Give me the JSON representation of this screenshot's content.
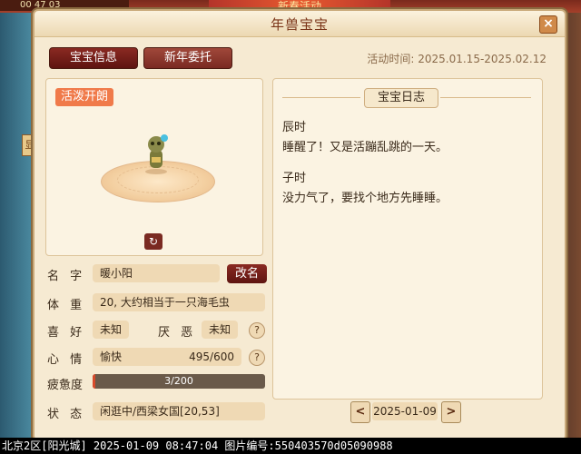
{
  "background": {
    "clock": "00 47 03",
    "banner": "新春活动",
    "side_button": "显"
  },
  "window": {
    "title": "年兽宝宝",
    "close_symbol": "×"
  },
  "tabs": [
    {
      "label": "宝宝信息",
      "active": true
    },
    {
      "label": "新年委托",
      "active": false
    }
  ],
  "activity_time": "活动时间: 2025.01.15-2025.02.12",
  "pet": {
    "mood_badge": "活泼开朗",
    "rotate_symbol": "↻"
  },
  "info": {
    "name_label": "名  字",
    "name_value": "暖小阳",
    "rename_button": "改名",
    "weight_label": "体  重",
    "weight_value": "20, 大约相当于一只海毛虫",
    "like_label": "喜  好",
    "like_value": "未知",
    "dislike_label": "厌  恶",
    "dislike_value": "未知",
    "mood_label": "心  情",
    "mood_value": "愉快",
    "mood_score": "495/600",
    "fatigue_label": "疲惫度",
    "fatigue_text": "3/200",
    "fatigue_fraction": 0.015,
    "status_label": "状  态",
    "status_value": "闲逛中/西梁女国[20,53]",
    "help_symbol": "?"
  },
  "diary": {
    "title": "宝宝日志",
    "entries": [
      {
        "time": "辰时",
        "text": "睡醒了！又是活蹦乱跳的一天。"
      },
      {
        "time": "子时",
        "text": "没力气了，要找个地方先睡睡。"
      }
    ],
    "date": "2025-01-09",
    "prev_symbol": "<",
    "next_symbol": ">"
  },
  "status_bar": "北京2区[阳光城] 2025-01-09 08:47:04 图片编号:550403570d05090988",
  "colors": {
    "accent_dark_red": "#5e1410",
    "panel_bg": "#fbf3e2",
    "field_bg": "#efd9b4",
    "fatigue_fill": "#d84a2a"
  }
}
